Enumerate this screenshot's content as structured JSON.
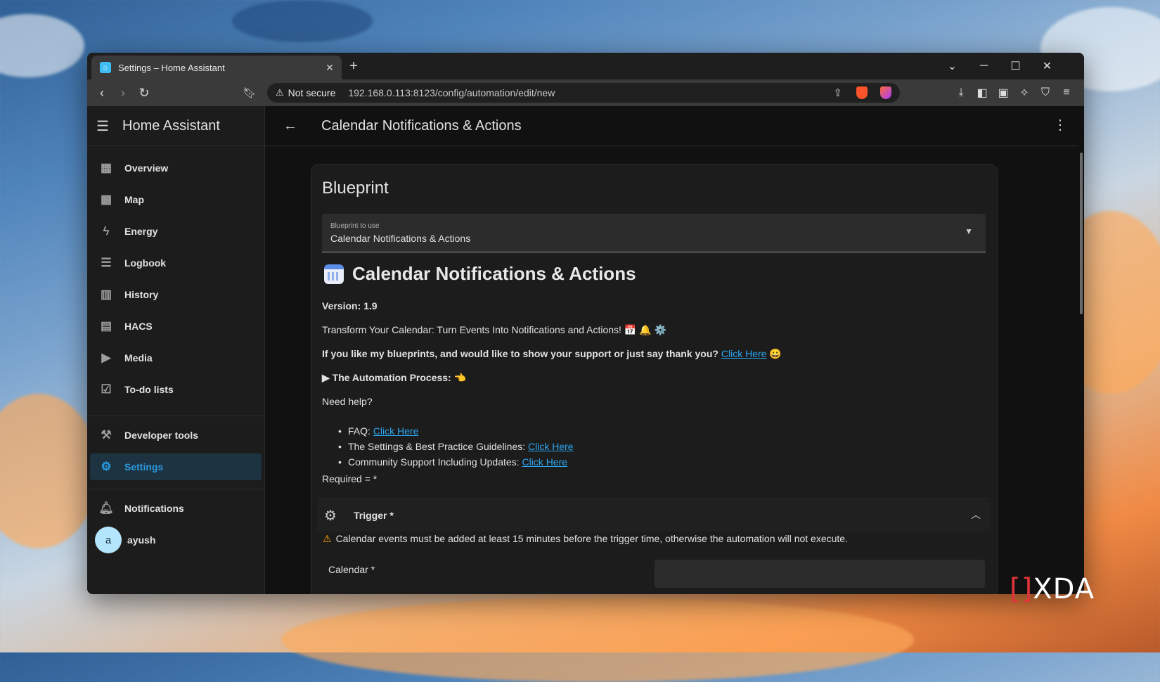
{
  "browser": {
    "tab_title": "Settings – Home Assistant",
    "tab_close": "✕",
    "new_tab": "+",
    "security_label": "Not secure",
    "url": "192.168.0.113:8123/config/automation/edit/new",
    "window_controls": [
      "⌄",
      "─",
      "☐",
      "✕"
    ]
  },
  "sidebar": {
    "app_title": "Home Assistant",
    "items": [
      {
        "label": "Overview",
        "icon": "overview-icon"
      },
      {
        "label": "Map",
        "icon": "map-icon"
      },
      {
        "label": "Energy",
        "icon": "energy-icon"
      },
      {
        "label": "Logbook",
        "icon": "logbook-icon"
      },
      {
        "label": "History",
        "icon": "history-icon"
      },
      {
        "label": "HACS",
        "icon": "hacs-icon"
      },
      {
        "label": "Media",
        "icon": "media-icon"
      },
      {
        "label": "To-do lists",
        "icon": "todo-icon"
      }
    ],
    "developer_tools": "Developer tools",
    "settings": "Settings",
    "notifications": "Notifications",
    "user_initial": "a",
    "user_name": "ayush"
  },
  "header": {
    "title": "Calendar Notifications & Actions"
  },
  "blueprint": {
    "heading": "Blueprint",
    "select_label": "Blueprint to use",
    "select_value": "Calendar Notifications & Actions",
    "title": "Calendar Notifications & Actions",
    "version": "Version: 1.9",
    "description": "Transform Your Calendar: Turn Events Into Notifications and Actions! 📅 🔔 ⚙️",
    "support_text": "If you like my blueprints, and would like to show your support or just say thank you?",
    "support_link": "Click Here",
    "support_emoji": "😀",
    "process_summary": "▶ The Automation Process: 👈",
    "need_help": "Need help?",
    "help_items": [
      {
        "text": "FAQ:",
        "link": "Click Here"
      },
      {
        "text": "The Settings & Best Practice Guidelines:",
        "link": "Click Here"
      },
      {
        "text": "Community Support Including Updates:",
        "link": "Click Here"
      }
    ],
    "required_note": "Required = *"
  },
  "trigger": {
    "label": "Trigger *",
    "warning": "Calendar events must be added at least 15 minutes before the trigger time, otherwise the automation will not execute.",
    "calendar_label": "Calendar *"
  },
  "watermark": {
    "bracket": "[]",
    "text": "XDA"
  },
  "colors": {
    "accent": "#2a9ae0",
    "link": "#2ba6f0",
    "warning": "#ffa600"
  }
}
